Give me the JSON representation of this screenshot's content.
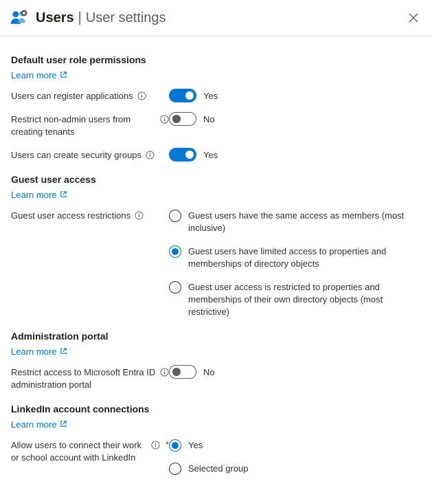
{
  "header": {
    "title_main": "Users",
    "title_separator": "|",
    "title_sub": "User settings"
  },
  "sections": {
    "default_perms": {
      "title": "Default user role permissions",
      "learn_more": "Learn more",
      "settings": {
        "register_apps": {
          "label": "Users can register applications",
          "toggle_on": true,
          "value_text": "Yes"
        },
        "restrict_tenants": {
          "label": "Restrict non-admin users from creating tenants",
          "toggle_on": false,
          "value_text": "No"
        },
        "security_groups": {
          "label": "Users can create security groups",
          "toggle_on": true,
          "value_text": "Yes"
        }
      }
    },
    "guest_access": {
      "title": "Guest user access",
      "learn_more": "Learn more",
      "restrictions": {
        "label": "Guest user access restrictions",
        "options": [
          "Guest users have the same access as members (most inclusive)",
          "Guest users have limited access to properties and memberships of directory objects",
          "Guest user access is restricted to properties and memberships of their own directory objects (most restrictive)"
        ],
        "selected_index": 1
      }
    },
    "admin_portal": {
      "title": "Administration portal",
      "learn_more": "Learn more",
      "restrict_portal": {
        "label": "Restrict access to Microsoft Entra ID administration portal",
        "toggle_on": false,
        "value_text": "No"
      }
    },
    "linkedin": {
      "title": "LinkedIn account connections",
      "learn_more": "Learn more",
      "connect": {
        "label": "Allow users to connect their work or school account with LinkedIn",
        "required": true,
        "options": [
          "Yes",
          "Selected group"
        ],
        "selected_index": 0
      }
    }
  }
}
